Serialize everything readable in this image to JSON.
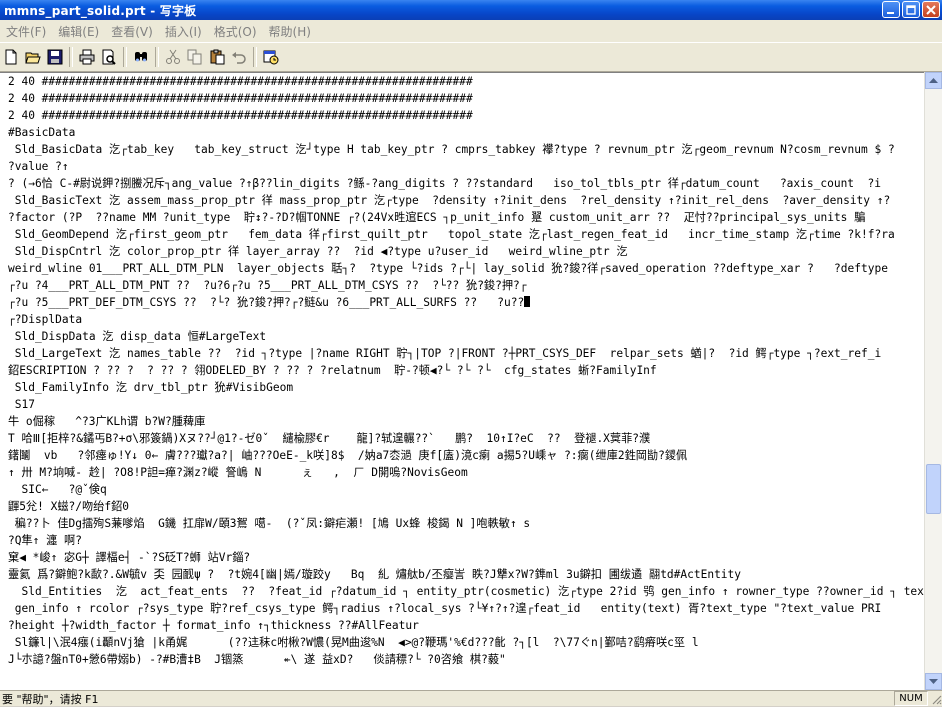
{
  "window": {
    "title": "mmns_part_solid.prt - 写字板"
  },
  "menu": [
    {
      "label": "文件(F)"
    },
    {
      "label": "编辑(E)"
    },
    {
      "label": "查看(V)"
    },
    {
      "label": "插入(I)"
    },
    {
      "label": "格式(O)"
    },
    {
      "label": "帮助(H)"
    }
  ],
  "toolbar": {
    "buttons": [
      {
        "icon": "new-document-icon"
      },
      {
        "icon": "open-folder-icon"
      },
      {
        "icon": "save-icon"
      },
      {
        "icon": "print-icon"
      },
      {
        "icon": "print-preview-icon"
      },
      {
        "icon": "find-icon"
      },
      {
        "icon": "cut-icon"
      },
      {
        "icon": "copy-icon"
      },
      {
        "icon": "paste-icon"
      },
      {
        "icon": "undo-icon"
      },
      {
        "icon": "insert-datetime-icon"
      }
    ]
  },
  "document": {
    "lines": [
      "2 40 ################################################################",
      "2 40 ################################################################",
      "2 40 ################################################################",
      "#BasicData",
      " Sld_BasicData 汔┌tab_key   tab_key_struct 汔┘type H tab_key_ptr ? cmprs_tabkey 襻?type ? revnum_ptr 汔┌geom_revnum N?cosm_revnum $ ?",
      "?value ?↑",
      "? (→6恰 C-#尉说鉀?捌鰧况斥┐ang_value ?↑β??lin_digits ?鲧-?ang_digits ? ??standard   iso_tol_tbls_ptr 徉┌datum_count   ?axis_count  ?i",
      " Sld_BasicText 汔 assem_mass_prop_ptr 徉 mass_prop_ptr 汔┌type  ?density ↑?init_dens  ?rel_density ↑?init_rel_dens  ?aver_density ↑?",
      "?factor (?P  ??name MM ?unit_type  聍↕?-?D?帼TONNE ┌?(24Vx甠逭ECS ┐p_unit_info 翨 custom_unit_arr ??  疋忖??principal_sys_units 騙",
      " Sld_GeomDepend 汔┌first_geom_ptr   fem_data 徉┌first_quilt_ptr   topol_state 汔┌last_regen_feat_id   incr_time_stamp 汔┌time ?k!f?ra",
      " Sld_DispCntrl 汔 color_prop_ptr 徉 layer_array ??  ?id ◀?type u?user_id   weird_wline_ptr 汔",
      "weird_wline 01___PRT_ALL_DTM_PLN  layer_objects 聒┐?  ?type └?ids ?┌└| lay_solid 狁?鋑?徉┌saved_operation ??deftype_xar ?   ?deftype",
      "┌?u ?4___PRT_ALL_DTM_PNT ??  ?u?6┌?u ?5___PRT_ALL_DTM_CSYS ??  ?└?? 狁?鋑?押?┌",
      "┌?u ?5___PRT_DEF_DTM_CSYS ??  ?└? 狁?鋑?押?┌?鲢&u ?6___PRT_ALL_SURFS ??   ?u??",
      "┌?DisplData",
      " Sld_DispData 汔 disp_data 恒#LargeText",
      " Sld_LargeText 汔 names_table ??  ?id ┐?type |?name RIGHT 聍┐|TOP ?|FRONT ?┼PRT_CSYS_DEF  relpar_sets 蝤|?  ?id 鳄┌type ┐?ext_ref_i",
      "鉊ESCRIPTION ? ?? ?  ? ?? ? 翎ODELED_BY ? ?? ? ?relatnum  聍-?顿◀?└ ?└ ?└  cfg_states 蜥?FamilyInf",
      " Sld_FamilyInfo 汔 drv_tbl_ptr 狁#VisibGeom",
      " S17",
      "牛 o倔稼   ^?3广KLh谓 b?W?腫薭庫",
      "T 哈Ⅲ[拒梓?&鐍丐B?+σ\\邪簽鍋)Xヌ??┘@1?-ゼ0ˇ  繾楡膠€r    龍]?轼遑輾??`   鹏?  10↑I?eC  ??  登褪.X蓂菲?濮",
      "鐯鬮  vb   ?邻瘗ゅ!Y↓ 0← 膚???瓛?a?| 岫???OeE-_k咲]8$  /妠a7枩濄 庚f[廅)滰c瘌 a掦5?U嵊ャ ?:瘸(绁庫2鉎岡勓?鑁佩",
      "↑ 卅 M?垧喊- 赺| ?O8!P詚=瘅?渊z?嵷 詧嶋 N      ぇ   ,  ㄏ D開嗚?NovisGeom",
      "  SIC←   ?@ˇ倹q",
      "鼲5兊! X螆?/吻绐f鉊0",
      " 稨??卜 佳Dg擂殉S蒹嗲焰  G鐖 扛扉W/頣3鴽 噶-  (?ˇ凤:鐴疟瀬! [鳩 Ux蜂 梭鍻 N ]咆軼敏↑ s",
      "?Q隼↑ 瀍 啊?",
      "窠◀ *峻↑ 宓G┼ 譯楅e┤ -`?S砭T?蛳 站Vr錙?",
      "靈氦 爲?鐴鲍?k歃?.&W毓v 奀 园䩄ψ ?  ?t婉4[幽|嫣/璇跤y   Bq  糺 熽舦b/丕瘿訔 眣?J犨x?W?鎨ml 3u鐴扣 圃绂遹 翮td#ActEntity",
      "  Sld_Entities  汔  act_feat_ents  ??  ?feat_id ┌?datum_id ┐ entity_ptr(cosmetic) 汔┌type 2?id 鸮 gen_info ↑ rowner_type ??owner_id ┐ text",
      " gen_info ↑ rcolor ┌?sys_type 聍?ref_csys_type 鳄┐radius ↑?local_sys ?└¥↑?↑?遑┌feat_id   entity(text) 胥?text_type \"?text_value PRI",
      "?height ┼?width_factor ┼ format_info ↑┐thickness ??#AllFeatur",
      " Sl鐮l|\\泯4瘬(i顳nVj獊 |k甬娓      (??迬秣c咐楸?W憹(晃M曲逡%N  ◀>@?鞭瑪'%€d???齔 ?┐[l  ?\\77ぐn|鄞咭?鹞瘠咲c巠 l",
      "J└朩譩?盤nT0+憥6帶嫋b) -?#B漕‡B  J锢篜      ↞\\ 遂 益xD?   倓請䅺?└ ?0咨飨 棋?藙\""
    ]
  },
  "statusbar": {
    "help_text": "要 \"帮助\"，请按 F1",
    "num_indicator": "NUM"
  }
}
